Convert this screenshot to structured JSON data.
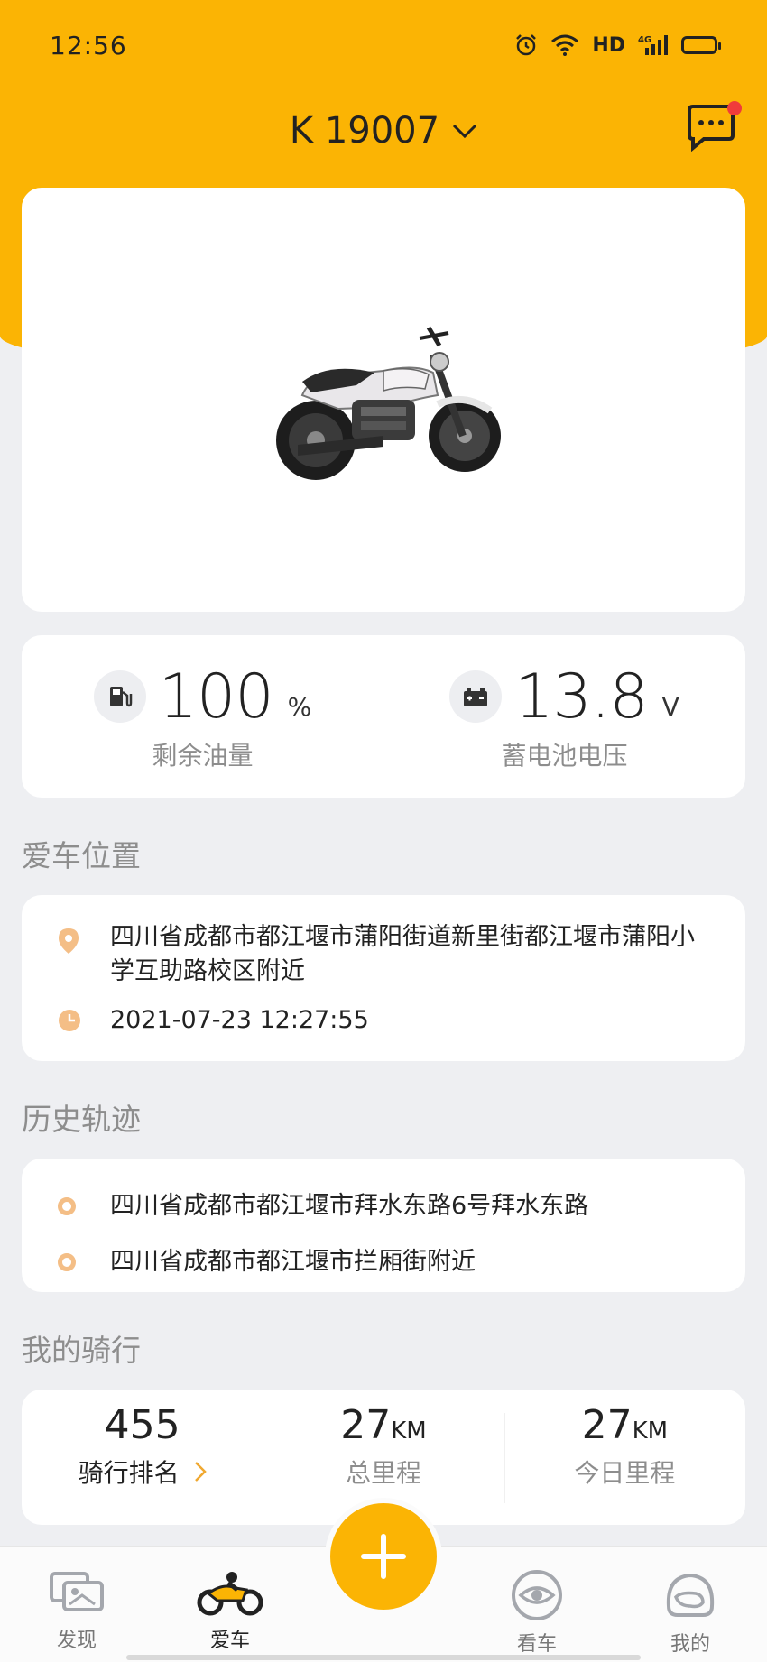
{
  "status_bar": {
    "time": "12:56",
    "network": "HD",
    "cellular": "4G"
  },
  "header": {
    "vehicle_id": "K 19007"
  },
  "stats": {
    "fuel": {
      "value": "100",
      "unit": "%",
      "label": "剩余油量"
    },
    "battery": {
      "value": "13.8",
      "unit": "V",
      "label": "蓄电池电压"
    }
  },
  "location": {
    "section_title": "爱车位置",
    "address": "四川省成都市都江堰市蒲阳街道新里街都江堰市蒲阳小学互助路校区附近",
    "time": "2021-07-23 12:27:55"
  },
  "history": {
    "section_title": "历史轨迹",
    "items": [
      "四川省成都市都江堰市拜水东路6号拜水东路",
      "四川省成都市都江堰市拦厢街附近"
    ]
  },
  "riding": {
    "section_title": "我的骑行",
    "rank": {
      "value": "455",
      "label": "骑行排名"
    },
    "total": {
      "value": "27",
      "unit": "KM",
      "label": "总里程"
    },
    "today": {
      "value": "27",
      "unit": "KM",
      "label": "今日里程"
    }
  },
  "tabs": [
    {
      "label": "发现",
      "icon": "discover-icon"
    },
    {
      "label": "爱车",
      "icon": "motorcycle-icon"
    },
    {
      "label": "看车",
      "icon": "eye-icon"
    },
    {
      "label": "我的",
      "icon": "helmet-icon"
    }
  ],
  "colors": {
    "accent": "#fbb404",
    "background": "#eeeff2",
    "badge": "#f03b3b",
    "location_icon": "#f4be86"
  }
}
